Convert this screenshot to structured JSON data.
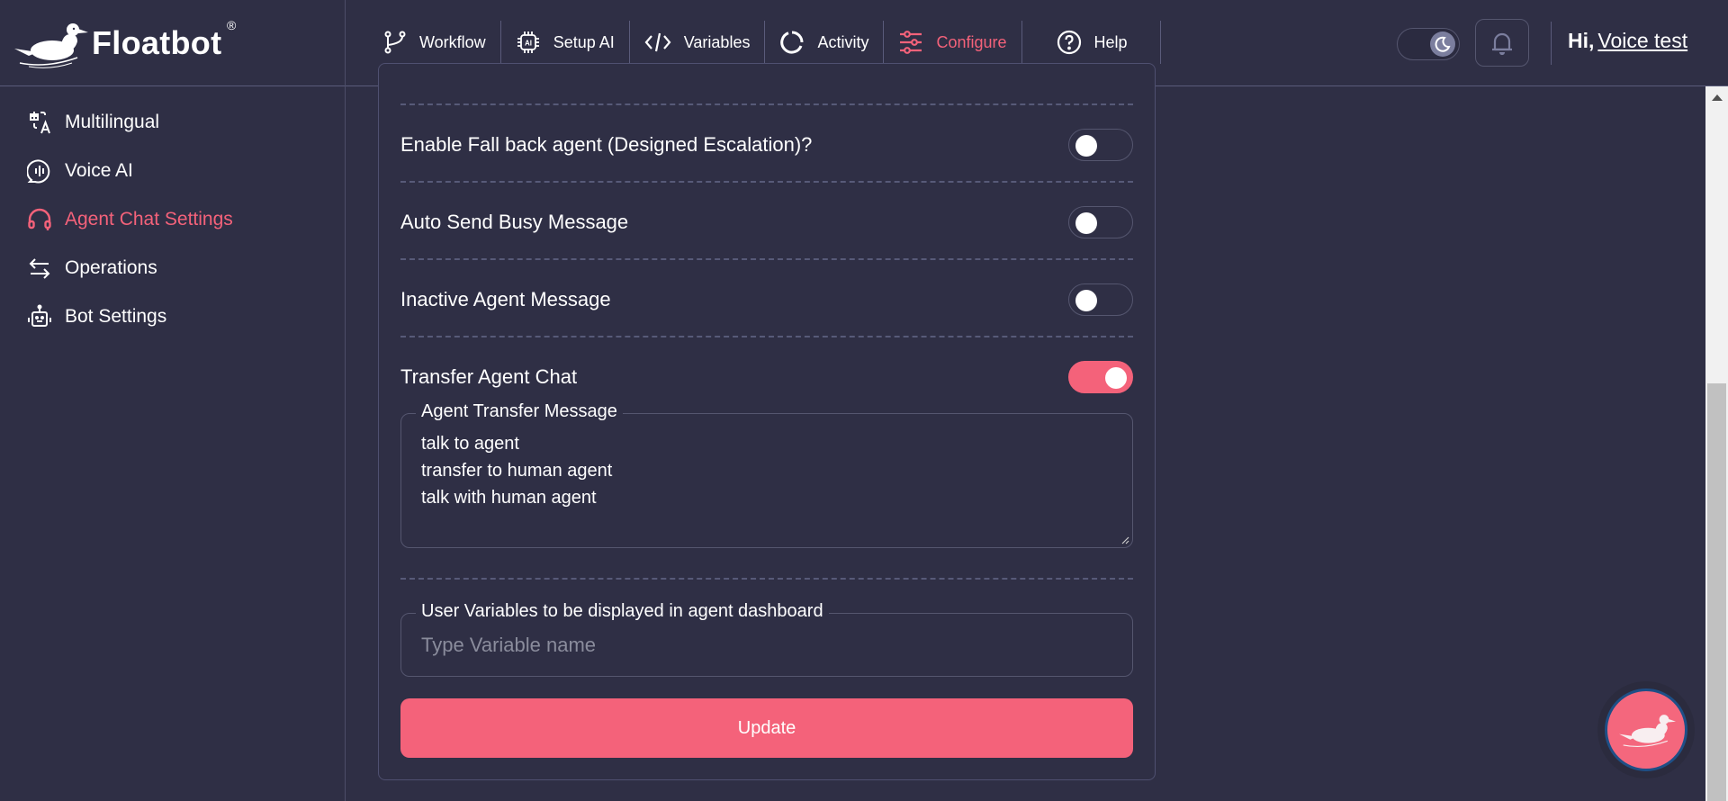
{
  "brand": {
    "name": "Floatbot",
    "registered": "®"
  },
  "nav": {
    "items": [
      {
        "label": "Workflow",
        "icon": "workflow-branch-icon",
        "active": false
      },
      {
        "label": "Setup AI",
        "icon": "ai-chip-icon",
        "active": false
      },
      {
        "label": "Variables",
        "icon": "code-icon",
        "active": false
      },
      {
        "label": "Activity",
        "icon": "activity-spinner-icon",
        "active": false
      },
      {
        "label": "Configure",
        "icon": "sliders-icon",
        "active": true
      },
      {
        "label": "Help",
        "icon": "help-circle-icon",
        "active": false
      }
    ]
  },
  "header": {
    "theme": "dark",
    "greeting_prefix": "Hi,",
    "username": "Voice test"
  },
  "sidebar": {
    "items": [
      {
        "label": "Multilingual",
        "icon": "translate-icon",
        "active": false
      },
      {
        "label": "Voice AI",
        "icon": "voice-wave-icon",
        "active": false
      },
      {
        "label": "Agent Chat Settings",
        "icon": "headset-icon",
        "active": true
      },
      {
        "label": "Operations",
        "icon": "arrows-exchange-icon",
        "active": false
      },
      {
        "label": "Bot Settings",
        "icon": "robot-icon",
        "active": false
      }
    ]
  },
  "settings": {
    "toggles": [
      {
        "label": "Enable Fall back agent (Designed Escalation)?",
        "on": false
      },
      {
        "label": "Auto Send Busy Message",
        "on": false
      },
      {
        "label": "Inactive Agent Message",
        "on": false
      },
      {
        "label": "Transfer Agent Chat",
        "on": true
      }
    ],
    "transfer_message": {
      "legend": "Agent Transfer Message",
      "value": "talk to agent\ntransfer to human agent\ntalk with human agent"
    },
    "user_variables": {
      "legend": "User Variables to be displayed in agent dashboard",
      "placeholder": "Type Variable name",
      "value": ""
    },
    "update_label": "Update"
  },
  "colors": {
    "background": "#2f2f45",
    "accent": "#f4627a",
    "border": "#55566f"
  }
}
